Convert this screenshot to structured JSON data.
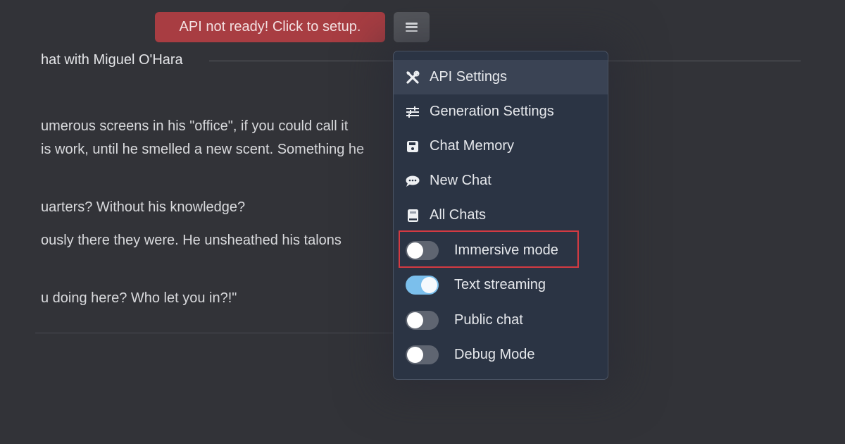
{
  "header": {
    "api_status_button": "API not ready! Click to setup.",
    "menu_button_icon": "hamburger-menu-icon"
  },
  "chat": {
    "title": "hat with Miguel O'Hara",
    "messages": [
      "umerous screens in his \"office\", if you could call it",
      "is work, until he smelled a new scent. Something he",
      "uarters? Without his knowledge?",
      "ously there they were. He unsheathed his talons",
      "u doing here? Who let you in?!\""
    ]
  },
  "menu": {
    "items": [
      {
        "label": "API Settings",
        "icon": "tools-icon"
      },
      {
        "label": "Generation Settings",
        "icon": "sliders-icon"
      },
      {
        "label": "Chat Memory",
        "icon": "floppy-disk-icon"
      },
      {
        "label": "New Chat",
        "icon": "chat-bubble-icon"
      },
      {
        "label": "All Chats",
        "icon": "book-icon"
      }
    ],
    "toggles": [
      {
        "label": "Immersive mode",
        "on": false
      },
      {
        "label": "Text streaming",
        "on": true
      },
      {
        "label": "Public chat",
        "on": false
      },
      {
        "label": "Debug Mode",
        "on": false
      }
    ]
  },
  "colors": {
    "api_button_bg": "#a83d42",
    "toggle_on": "#7bbfec",
    "highlight_border": "#d33a42"
  }
}
